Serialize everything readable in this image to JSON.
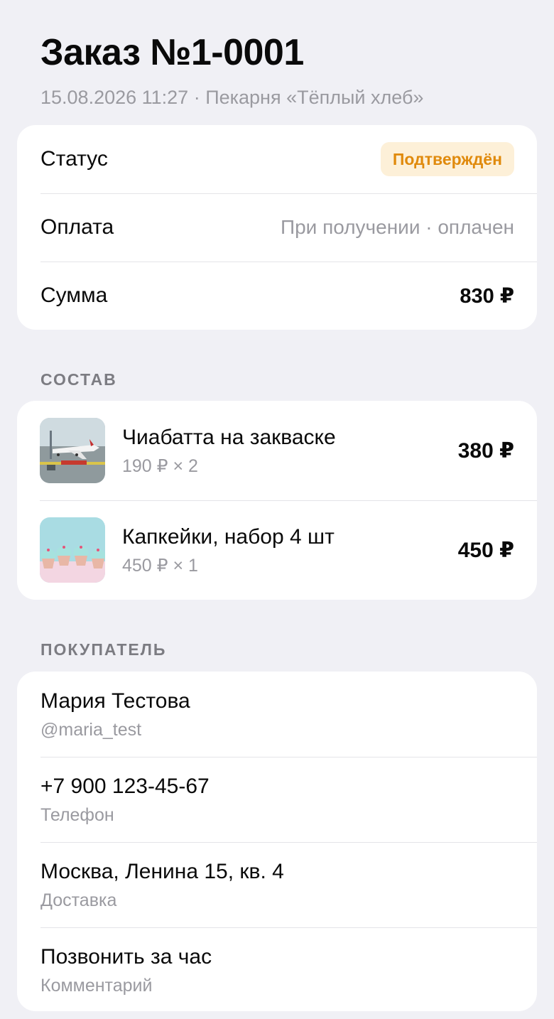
{
  "order": {
    "title": "Заказ №1-0001",
    "subtitle": "15.08.2026 11:27 · Пекарня «Тёплый хлеб»"
  },
  "summary": {
    "status_label": "Статус",
    "status_value": "Подтверждён",
    "payment_label": "Оплата",
    "payment_value": "При получении · оплачен",
    "total_label": "Сумма",
    "total_value": "830 ₽"
  },
  "composition": {
    "section_title": "СОСТАВ",
    "items": [
      {
        "name": "Чиабатта на закваске",
        "qty": "190 ₽ × 2",
        "total": "380 ₽",
        "thumb": "airplane-photo"
      },
      {
        "name": "Капкейки, набор 4 шт",
        "qty": "450 ₽ × 1",
        "total": "450 ₽",
        "thumb": "cupcakes-photo"
      }
    ]
  },
  "buyer": {
    "section_title": "ПОКУПАТЕЛЬ",
    "name": "Мария Тестова",
    "username": "@maria_test",
    "phone": "+7 900 123-45-67",
    "phone_label": "Телефон",
    "address": "Москва, Ленина 15, кв. 4",
    "address_label": "Доставка",
    "comment": "Позвонить за час",
    "comment_label": "Комментарий"
  },
  "colors": {
    "background": "#f0f0f5",
    "badge_bg": "#fdf0d8",
    "badge_text": "#e08a0c",
    "muted_text": "#9a9aa0"
  }
}
